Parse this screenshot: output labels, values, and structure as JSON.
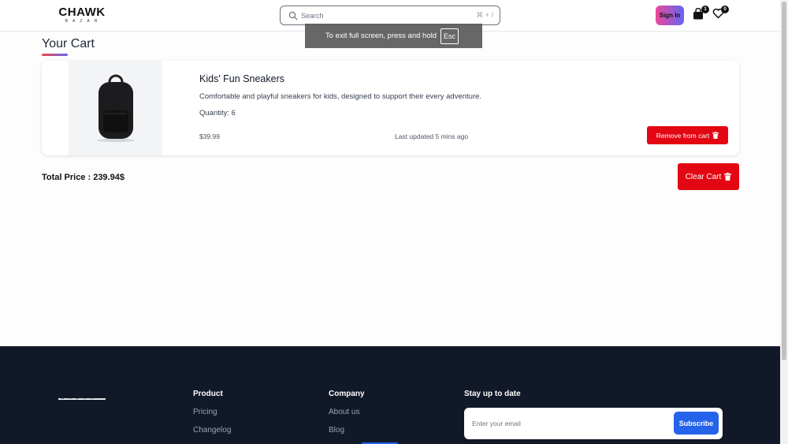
{
  "header": {
    "logo_main": "CHAWK",
    "logo_sub": "BAZAR",
    "search": {
      "placeholder": "Search",
      "shortcut": "⌘ + /"
    },
    "signin_label": "Sign In",
    "cart_icon": "shopping-bag-icon",
    "cart_count": "1",
    "wishlist_icon": "heart-icon",
    "wishlist_count": "0"
  },
  "fullscreen_toast": {
    "text": "To exit full screen, press and hold",
    "key": "Esc"
  },
  "cart": {
    "title": "Your Cart",
    "items": [
      {
        "image_icon": "backpack-image",
        "name": "Kids' Fun Sneakers",
        "description": "Comfortable and playful sneakers for kids, designed to support their every adventure.",
        "quantity_text": "Quantity: 6",
        "price": "$39.99",
        "updated": "Last updated 5 mins ago",
        "remove_label": "Remove from cart"
      }
    ],
    "total_text": "Total Price : 239.94$",
    "clear_label": "Clear Cart"
  },
  "footer": {
    "logo_sub": "BAZAR",
    "product": {
      "heading": "Product",
      "links": [
        "Pricing",
        "Changelog"
      ]
    },
    "company": {
      "heading": "Company",
      "links": [
        "About us",
        "Blog"
      ]
    },
    "newsletter": {
      "heading": "Stay up to date",
      "email_placeholder": "Enter your email",
      "subscribe_label": "Subscribe"
    }
  },
  "colors": {
    "accent_red": "#e30613",
    "footer_bg": "#111827",
    "subscribe_blue": "#2563eb",
    "signin_gradient_start": "#ec4899",
    "signin_gradient_end": "#6366f1"
  }
}
